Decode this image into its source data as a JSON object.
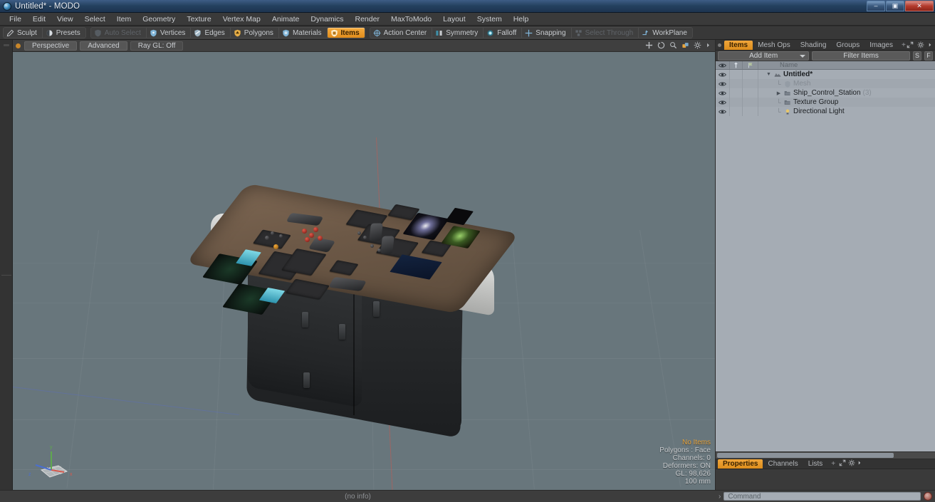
{
  "window": {
    "title": "Untitled* - MODO",
    "app_icon": "modo-sphere-icon",
    "minimize_glyph": "–",
    "maximize_glyph": "▣",
    "close_glyph": "✕"
  },
  "menubar": {
    "items": [
      {
        "label": "File"
      },
      {
        "label": "Edit"
      },
      {
        "label": "View"
      },
      {
        "label": "Select"
      },
      {
        "label": "Item"
      },
      {
        "label": "Geometry"
      },
      {
        "label": "Texture"
      },
      {
        "label": "Vertex Map"
      },
      {
        "label": "Animate"
      },
      {
        "label": "Dynamics"
      },
      {
        "label": "Render"
      },
      {
        "label": "MaxToModo"
      },
      {
        "label": "Layout"
      },
      {
        "label": "System"
      },
      {
        "label": "Help"
      }
    ]
  },
  "modebar": {
    "group_left": [
      {
        "label": "Sculpt",
        "icon": "pencil-icon",
        "state": "normal"
      },
      {
        "label": "Presets",
        "icon": "sphere-preset-icon",
        "state": "normal"
      }
    ],
    "group_select": [
      {
        "label": "Auto Select",
        "icon": "shield-icon",
        "state": "disabled"
      },
      {
        "label": "Vertices",
        "icon": "vertex-shield-icon",
        "state": "normal"
      },
      {
        "label": "Edges",
        "icon": "edge-shield-icon",
        "state": "normal"
      },
      {
        "label": "Polygons",
        "icon": "polygon-shield-icon",
        "state": "normal"
      },
      {
        "label": "Materials",
        "icon": "material-shield-icon",
        "state": "normal"
      },
      {
        "label": "Items",
        "icon": "item-shield-icon",
        "state": "active"
      }
    ],
    "group_right": [
      {
        "label": "Action Center",
        "icon": "crosshair-icon",
        "state": "normal"
      },
      {
        "label": "Symmetry",
        "icon": "symmetry-icon",
        "state": "normal"
      },
      {
        "label": "Falloff",
        "icon": "falloff-icon",
        "state": "normal"
      },
      {
        "label": "Snapping",
        "icon": "snap-crosshair-icon",
        "state": "normal"
      },
      {
        "label": "Select Through",
        "icon": "select-through-icon",
        "state": "disabled"
      },
      {
        "label": "WorkPlane",
        "icon": "workplane-icon",
        "state": "normal"
      }
    ]
  },
  "viewport": {
    "header": {
      "indicator": "active-dot",
      "chips": [
        {
          "label": "Perspective"
        },
        {
          "label": "Advanced"
        },
        {
          "label": "Ray GL: Off"
        }
      ],
      "nav_icons": [
        {
          "name": "pan-icon"
        },
        {
          "name": "rotate-icon"
        },
        {
          "name": "zoom-magnifier-icon"
        },
        {
          "name": "fit-view-icon"
        },
        {
          "name": "viewport-settings-gear-icon"
        },
        {
          "name": "viewport-more-arrow-icon"
        }
      ]
    },
    "stats": {
      "selection": "No Items",
      "polygons": "Polygons : Face",
      "channels": "Channels: 0",
      "deformers": "Deformers: ON",
      "gl": "GL: 98,626",
      "grid_size": "100 mm"
    },
    "axis_gizmo": {
      "x_label": "x",
      "y_label": "y",
      "z_label": "z",
      "x_color": "#d45a4e",
      "y_color": "#5fa84f",
      "z_color": "#4a6fd0"
    },
    "model_name": "Ship_Control_Station"
  },
  "right_panel": {
    "tabs": [
      {
        "label": "Items",
        "active": true
      },
      {
        "label": "Mesh Ops",
        "active": false
      },
      {
        "label": "Shading",
        "active": false
      },
      {
        "label": "Groups",
        "active": false
      },
      {
        "label": "Images",
        "active": false
      },
      {
        "label": "+",
        "active": false
      }
    ],
    "toolbar": {
      "add_item_label": "Add Item",
      "filter_placeholder": "Filter Items",
      "s_button": "S",
      "f_button": "F"
    },
    "list_header": {
      "eye_icon": "eye-icon",
      "lock_icon": "pin-icon",
      "render_icon": "render-flag-icon",
      "name_column": "Name"
    },
    "items": [
      {
        "name": "Untitled*",
        "icon": "scene-icon",
        "indent": 0,
        "twisty": "open",
        "bold": true,
        "dim": false,
        "count": ""
      },
      {
        "name": "Mesh",
        "icon": "mesh-icon",
        "indent": 1,
        "twisty": "none",
        "bold": false,
        "dim": true,
        "count": ""
      },
      {
        "name": "Ship_Control_Station",
        "icon": "group-icon",
        "indent": 1,
        "twisty": "closed",
        "bold": false,
        "dim": false,
        "count": "(3)"
      },
      {
        "name": "Texture Group",
        "icon": "group-icon",
        "indent": 1,
        "twisty": "none",
        "bold": false,
        "dim": false,
        "count": ""
      },
      {
        "name": "Directional Light",
        "icon": "light-icon",
        "indent": 1,
        "twisty": "none",
        "bold": false,
        "dim": false,
        "count": ""
      }
    ],
    "bottom_tabs": [
      {
        "label": "Properties",
        "active": true
      },
      {
        "label": "Channels",
        "active": false
      },
      {
        "label": "Lists",
        "active": false
      },
      {
        "label": "+",
        "active": false
      }
    ],
    "panel_icons": [
      {
        "name": "maximize-panel-icon"
      },
      {
        "name": "panel-settings-gear-icon"
      },
      {
        "name": "panel-more-arrow-icon"
      }
    ]
  },
  "statusbar": {
    "text": "(no info)"
  },
  "command_bar": {
    "caret": "›",
    "placeholder": "Command",
    "record_icon": "record-macro-icon"
  },
  "colors": {
    "accent_orange": "#e8a33a",
    "viewport_bg": "#68767c",
    "panel_bg": "#3a3a3a",
    "list_bg": "#a5acb4",
    "titlebar_blue": "#24415f"
  }
}
